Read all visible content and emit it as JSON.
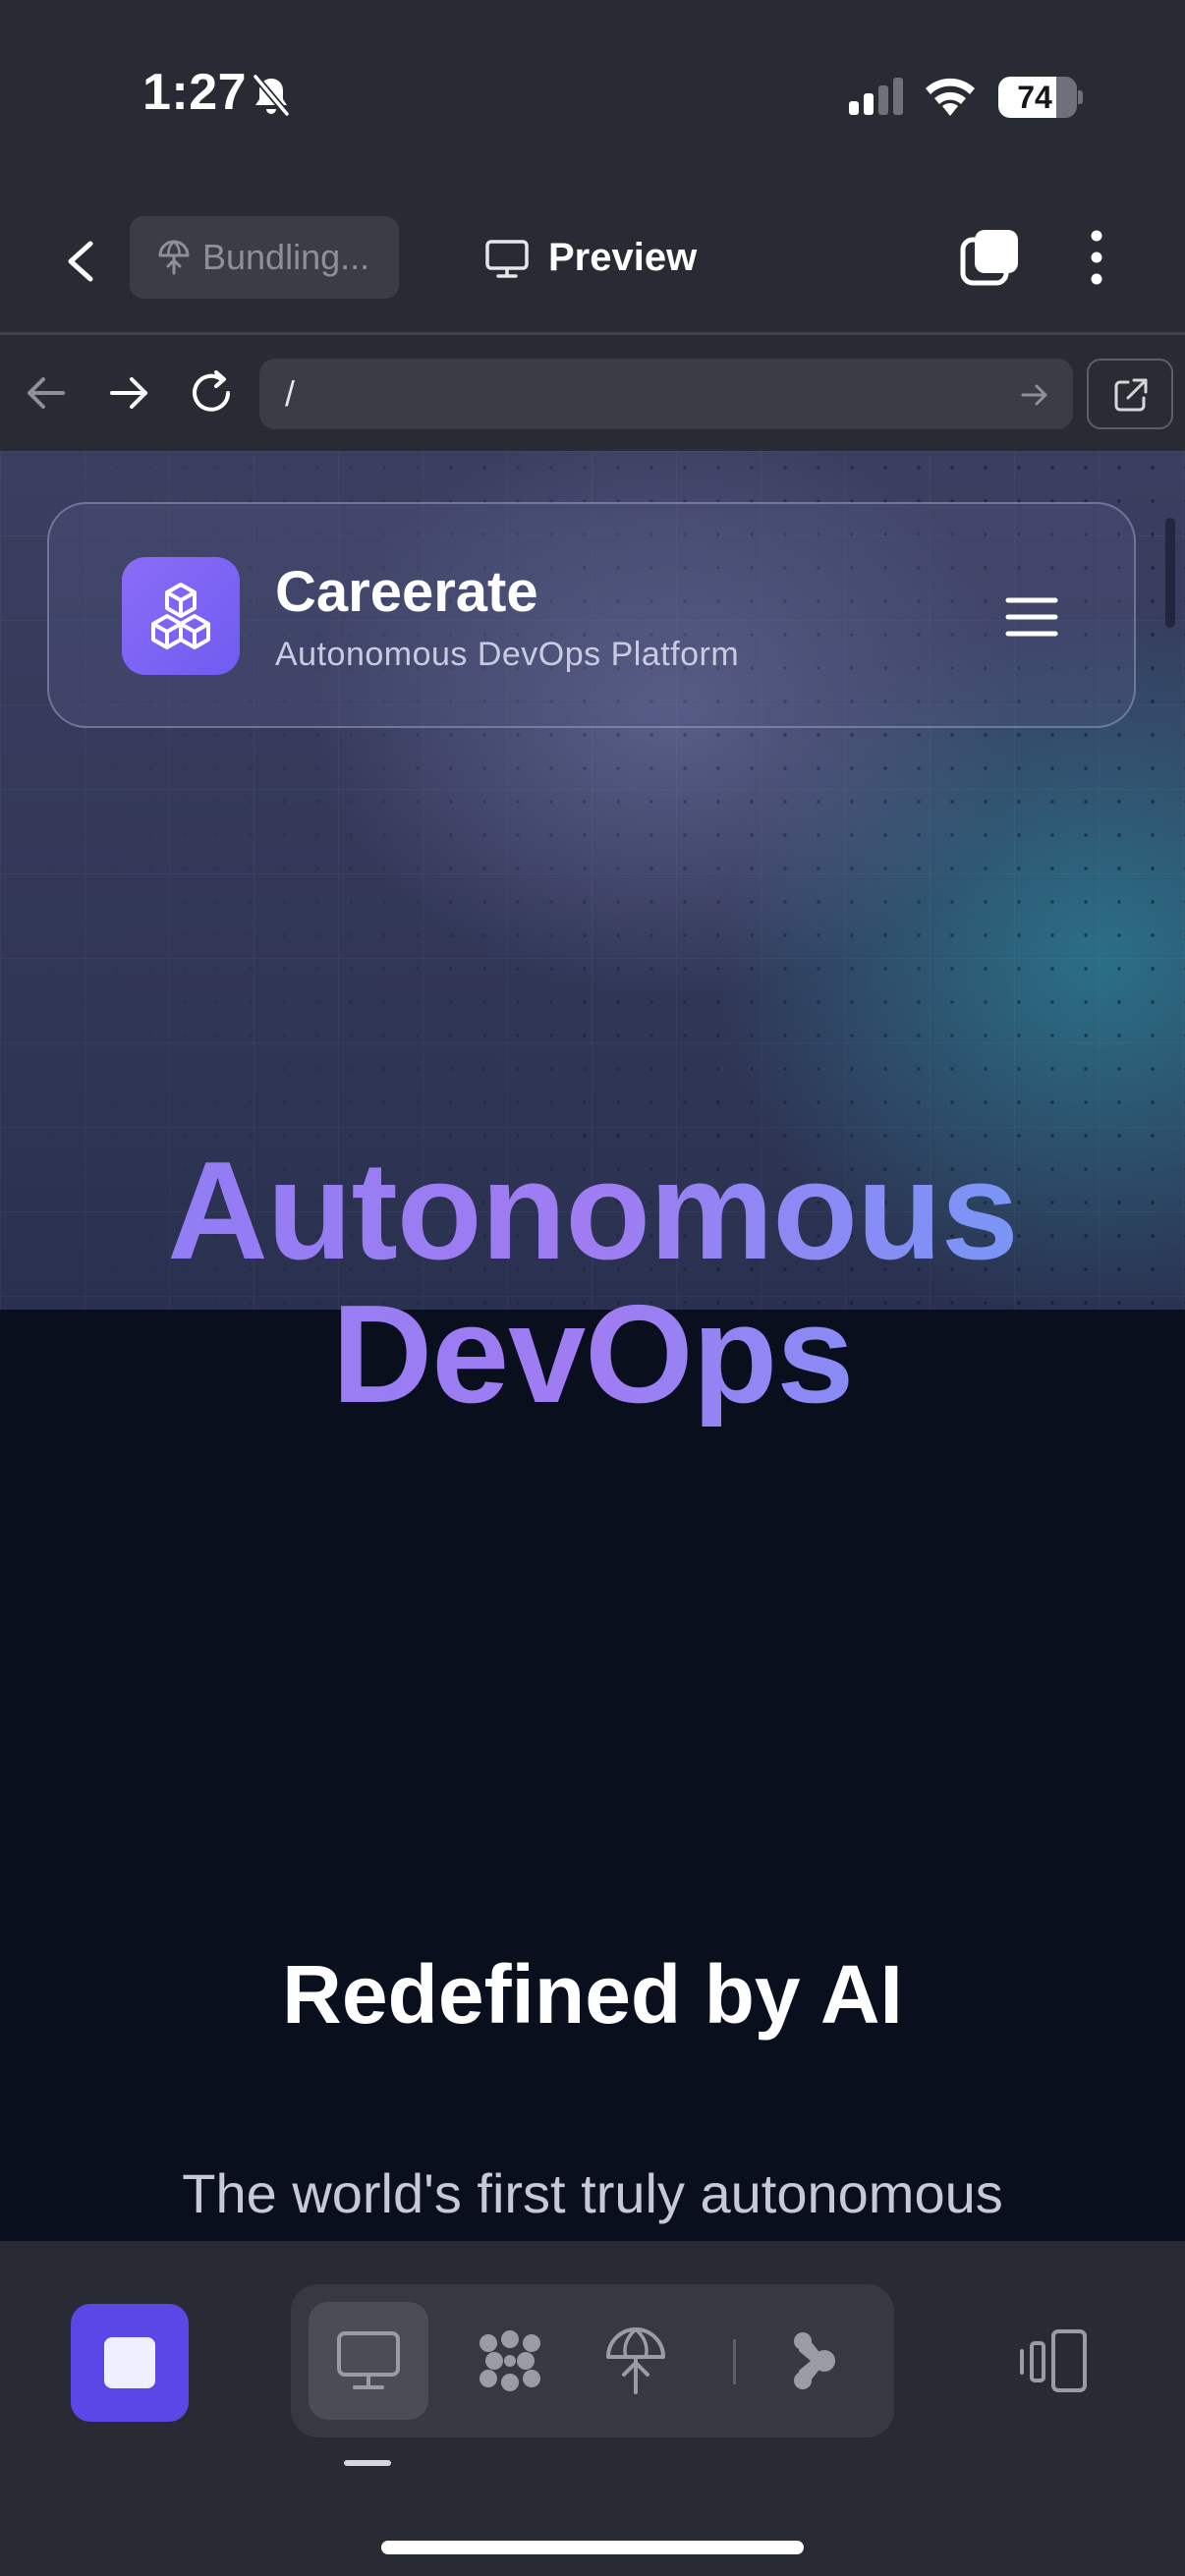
{
  "status_bar": {
    "time": "1:27",
    "battery": "74",
    "battery_level": 0.74,
    "icons": [
      "bell-slash-icon",
      "signal-icon",
      "wifi-icon",
      "battery-icon"
    ]
  },
  "header": {
    "bundling_label": "Bundling...",
    "preview_label": "Preview",
    "icons": [
      "chevron-left-icon",
      "umbrella-icon",
      "monitor-icon",
      "tabs-icon",
      "more-vertical-icon"
    ]
  },
  "browser": {
    "url": "/",
    "icons": [
      "arrow-left-icon",
      "arrow-right-icon",
      "reload-icon",
      "arrow-right-go-icon",
      "external-link-icon"
    ]
  },
  "site": {
    "brand_name": "Careerate",
    "tagline": "Autonomous DevOps Platform",
    "hero_line1": "Autonomous",
    "hero_line2": "DevOps",
    "subheading": "Redefined by AI",
    "body": "The world's first truly autonomous",
    "icons": [
      "cubes-icon",
      "hamburger-icon"
    ]
  },
  "bottom_bar": {
    "icons": [
      "stop-icon",
      "monitor-icon",
      "cluster-icon",
      "deploy-icon",
      "agent-icon",
      "layout-icon"
    ]
  },
  "colors": {
    "chrome_bg": "#292b34",
    "accent_purple": "#5b47e6",
    "logo_gradient_start": "#8b6cf7",
    "hero_gradient_start": "#8c7ef5",
    "hero_gradient_end": "#6aa0f8",
    "page_dark_bg": "#0a0f1e"
  }
}
